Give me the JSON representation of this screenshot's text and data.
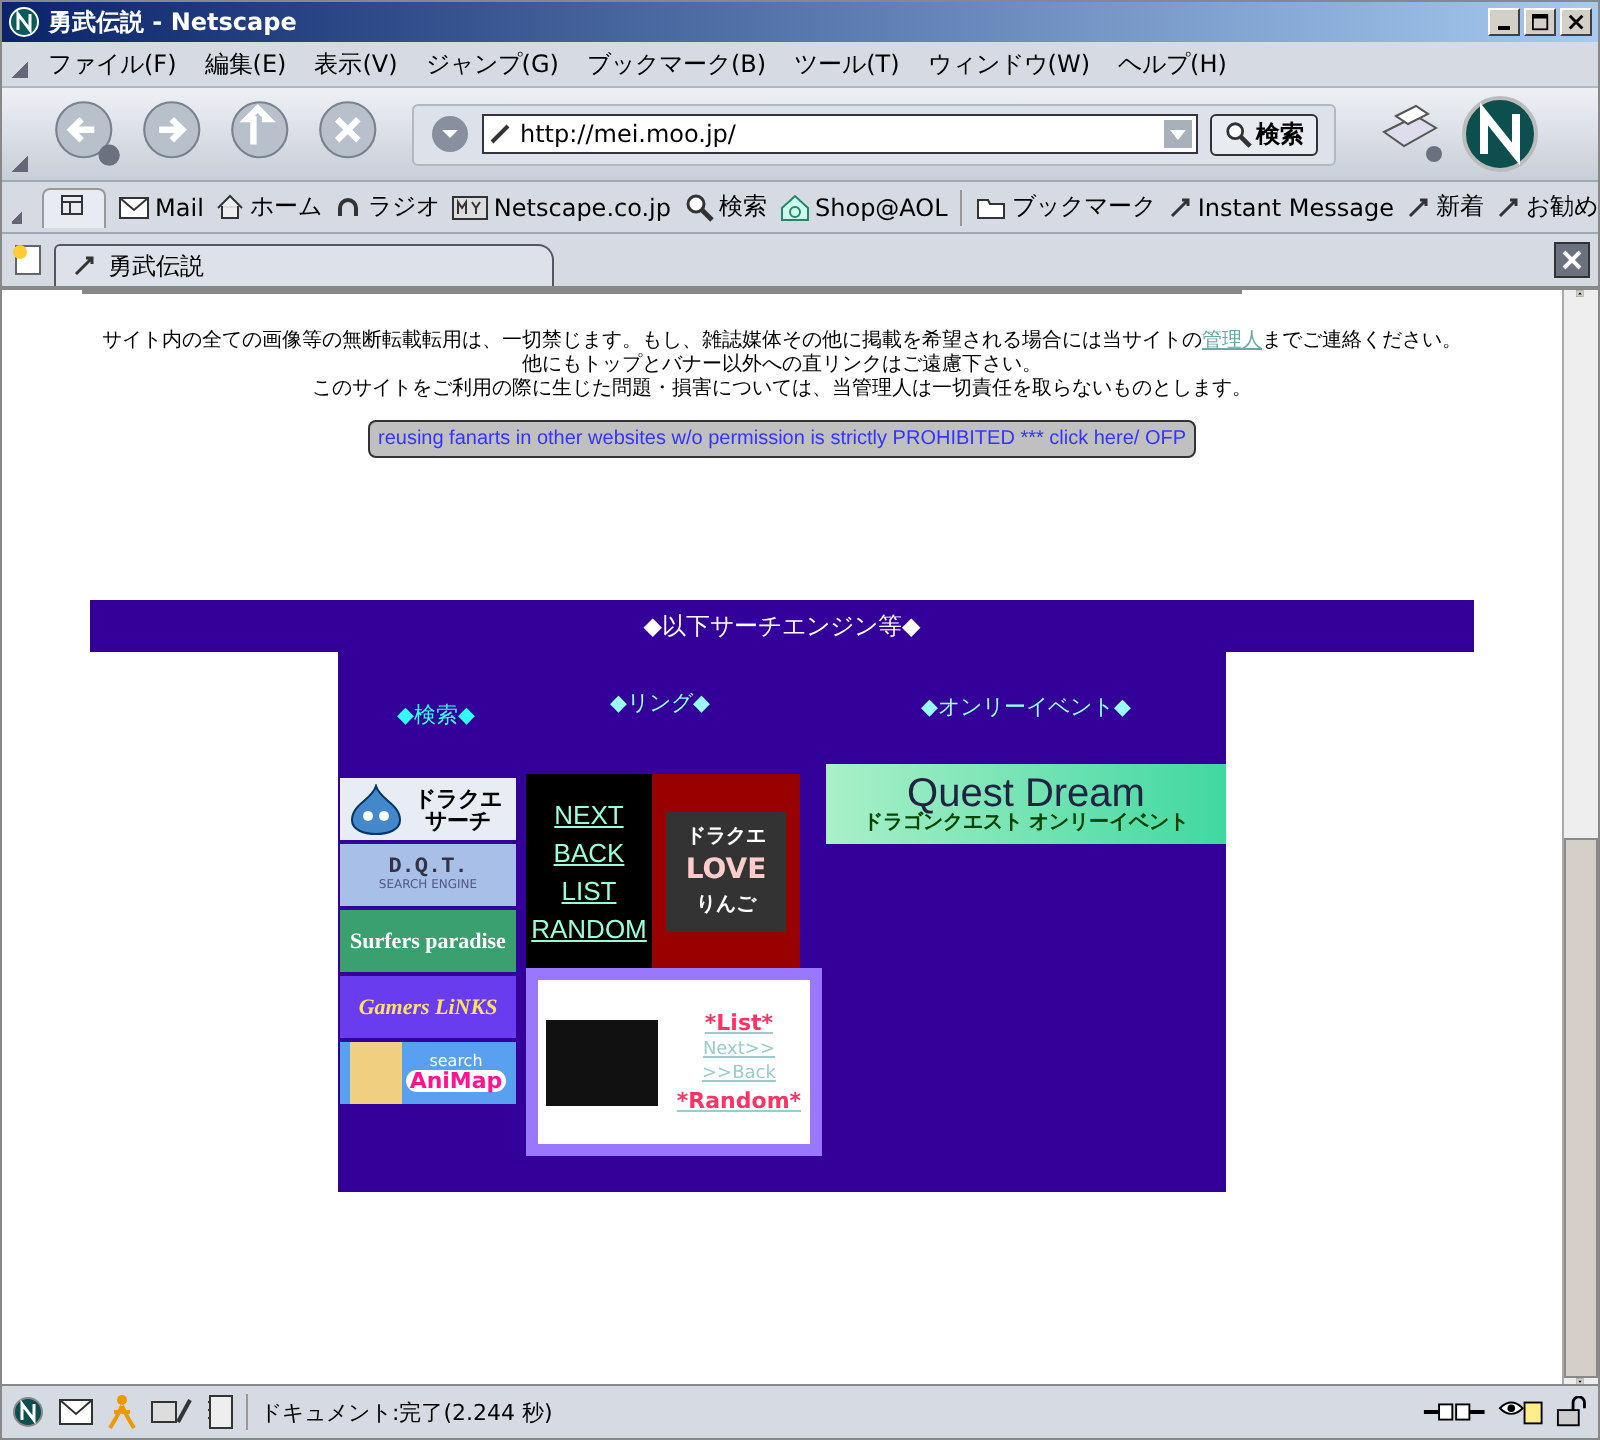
{
  "window": {
    "title": "勇武伝説 - Netscape"
  },
  "menu": [
    "ファイル(F)",
    "編集(E)",
    "表示(V)",
    "ジャンプ(G)",
    "ブックマーク(B)",
    "ツール(T)",
    "ウィンドウ(W)",
    "ヘルプ(H)"
  ],
  "navigation": {
    "url": "http://mei.moo.jp/",
    "search_button": "検索"
  },
  "personal_toolbar": [
    {
      "label": "Mail",
      "kind": "mail"
    },
    {
      "label": "ホーム",
      "kind": "home"
    },
    {
      "label": "ラジオ",
      "kind": "radio"
    },
    {
      "label": "Netscape.co.jp",
      "kind": "my"
    },
    {
      "label": "検索",
      "kind": "search"
    },
    {
      "label": "Shop@AOL",
      "kind": "shop"
    },
    {
      "label": "ブックマーク",
      "kind": "folder"
    },
    {
      "label": "Instant Message",
      "kind": "link"
    },
    {
      "label": "新着",
      "kind": "link"
    },
    {
      "label": "お勧め",
      "kind": "link"
    }
  ],
  "tab": {
    "title": "勇武伝説"
  },
  "page": {
    "notice": {
      "line_1_before": "サイト内の全ての画像等の無断転載転用は、一切禁じます。もし、雑誌媒体その他に掲載を希望される場合には当サイトの",
      "line_1_link": "管理人",
      "line_1_after": "までご連絡ください。",
      "line_2": "他にもトップとバナー以外への直リンクはご遠慮下さい。",
      "line_3": "このサイトをご利用の際に生じた問題・損害については、当管理人は一切責任を取らないものとします。"
    },
    "warning_button": "reusing fanarts in other websites w/o permission is strictly PROHIBITED *** click here/ OFP",
    "section_title": "◆以下サーチエンジン等◆",
    "search": {
      "heading": "◆検索◆",
      "banners": [
        {
          "kind": "slime",
          "text": "ドラクエ",
          "subtext": "サーチ"
        },
        {
          "kind": "dqt",
          "text": "D.Q.T.",
          "subtext": "SEARCH ENGINE"
        },
        {
          "kind": "surfers",
          "text": "Surfers paradise"
        },
        {
          "kind": "gamers",
          "text": "Gamers LiNKS"
        },
        {
          "kind": "animap",
          "subtext": "search",
          "text": "AniMap"
        }
      ]
    },
    "ring": {
      "heading": "◆リング◆",
      "links": [
        "NEXT",
        "BACK",
        "LIST",
        "RANDOM"
      ],
      "banner": {
        "line_1": "ドラクエ",
        "line_2": "LOVE",
        "line_3": "りんご"
      },
      "links_2": [
        {
          "label": "*List*",
          "kind": "strong"
        },
        {
          "label": "Next>>",
          "kind": "plain"
        },
        {
          "label": ">>Back",
          "kind": "plain"
        },
        {
          "label": "*Random*",
          "kind": "strong"
        }
      ]
    },
    "event": {
      "heading": "◆オンリーイベント◆",
      "banner": {
        "title": "Quest Dream",
        "subtitle": "ドラゴンクエスト オンリーイベント"
      }
    }
  },
  "status_bar": {
    "text": "ドキュメント:完了(2.244 秒)"
  }
}
